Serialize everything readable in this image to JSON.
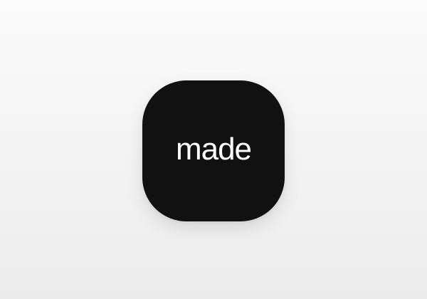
{
  "app_icon": {
    "label": "made",
    "icon_name": "app-icon",
    "background_color": "#111111",
    "text_color": "#ffffff"
  }
}
